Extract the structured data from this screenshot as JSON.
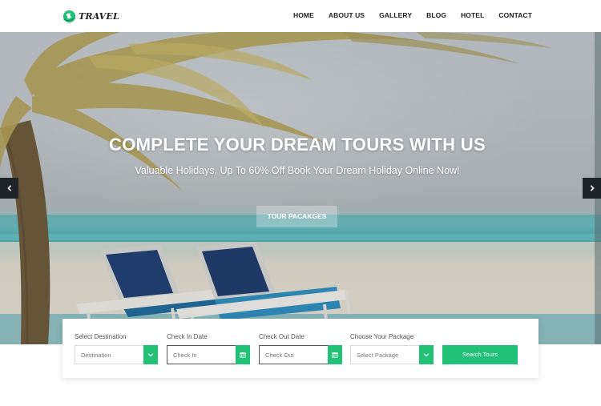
{
  "header": {
    "logo_text": "TRAVEL",
    "nav": [
      "HOME",
      "ABOUT US",
      "GALLERY",
      "BLOG",
      "HOTEL",
      "CONTACT"
    ]
  },
  "hero": {
    "title": "COMPLETE YOUR DREAM TOURS WITH US",
    "subtitle": "Valuable Holidays, Up To 60% Off Book Your Dream Holiday Online Now!",
    "button_label": "TOUR PACAKGES",
    "prev_icon": "chevron-left-icon",
    "next_icon": "chevron-right-icon"
  },
  "search": {
    "destination": {
      "label": "Select Destination",
      "value": "Destination",
      "icon": "chevron-down-icon"
    },
    "check_in": {
      "label": "Check In Date",
      "placeholder": "Check In",
      "icon": "calendar-icon"
    },
    "check_out": {
      "label": "Check Out Date",
      "placeholder": "Check Out",
      "icon": "calendar-icon"
    },
    "package": {
      "label": "Choose Your Package",
      "value": "Select Package",
      "icon": "chevron-down-icon"
    },
    "button_label": "Search Tours"
  },
  "colors": {
    "accent": "#21c178",
    "nav_text": "#222222",
    "arrow_bg": "#1f2428"
  }
}
